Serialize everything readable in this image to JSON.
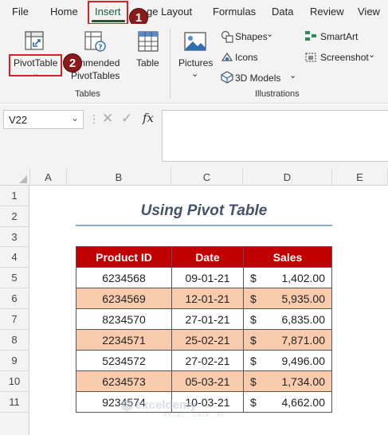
{
  "menu": {
    "items": [
      "File",
      "Home",
      "Insert",
      "ge Layout",
      "Formulas",
      "Data",
      "Review",
      "View"
    ]
  },
  "ribbon": {
    "pivot_label": "PivotTable",
    "recommended_line1": "mmended",
    "recommended_line2": "PivotTables",
    "table_label": "Table",
    "tables_group": "Tables",
    "pictures_label": "Pictures",
    "shapes_label": "Shapes",
    "icons_label": "Icons",
    "models_label": "3D Models",
    "smartart_label": "SmartArt",
    "screenshot_label": "Screenshot",
    "illustrations_group": "Illustrations"
  },
  "markers": {
    "one": "1",
    "two": "2"
  },
  "formula": {
    "namebox": "V22",
    "fx": "fx"
  },
  "columns": [
    "A",
    "B",
    "C",
    "D",
    "E"
  ],
  "rows": [
    "1",
    "2",
    "3",
    "4",
    "5",
    "6",
    "7",
    "8",
    "9",
    "10",
    "11"
  ],
  "sheet": {
    "title": "Using Pivot Table",
    "headers": [
      "Product ID",
      "Date",
      "Sales"
    ],
    "data": [
      {
        "id": "6234568",
        "date": "09-01-21",
        "cur": "$",
        "sales": "1,402.00"
      },
      {
        "id": "6234569",
        "date": "12-01-21",
        "cur": "$",
        "sales": "5,935.00"
      },
      {
        "id": "8234570",
        "date": "27-01-21",
        "cur": "$",
        "sales": "6,835.00"
      },
      {
        "id": "2234571",
        "date": "25-02-21",
        "cur": "$",
        "sales": "7,871.00"
      },
      {
        "id": "5234572",
        "date": "27-02-21",
        "cur": "$",
        "sales": "9,496.00"
      },
      {
        "id": "6234573",
        "date": "05-03-21",
        "cur": "$",
        "sales": "1,734.00"
      },
      {
        "id": "9234574",
        "date": "10-03-21",
        "cur": "$",
        "sales": "4,662.00"
      }
    ]
  },
  "watermark": {
    "name": "exceldemy",
    "tagline": "EXCEL · DATA · BI"
  },
  "colors": {
    "header_fill": "#c00000",
    "band_fill": "#f8cbad",
    "accent": "#185c37",
    "title": "#44546a"
  }
}
